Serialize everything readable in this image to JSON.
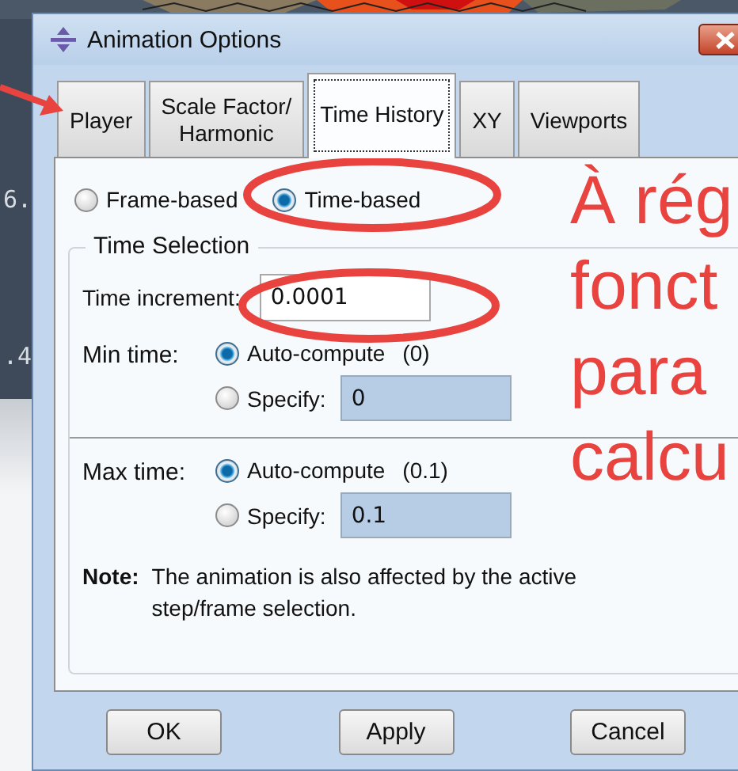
{
  "background_texts": [
    "6.",
    ".4"
  ],
  "window": {
    "title": "Animation Options"
  },
  "tabs": [
    {
      "label": "Player",
      "selected": false
    },
    {
      "label": "Scale Factor/\nHarmonic",
      "selected": false
    },
    {
      "label": "Time History",
      "selected": true
    },
    {
      "label": "XY",
      "selected": false
    },
    {
      "label": "Viewports",
      "selected": false
    }
  ],
  "mode_options": [
    {
      "label": "Frame-based",
      "selected": false
    },
    {
      "label": "Time-based",
      "selected": true
    }
  ],
  "time_selection": {
    "title": "Time Selection",
    "increment_label": "Time increment:",
    "increment_value": "0.0001",
    "limits": [
      {
        "label": "Min time:",
        "auto_label": "Auto-compute",
        "auto_value": "(0)",
        "auto_selected": true,
        "specify_label": "Specify:",
        "specify_value": "0",
        "specify_selected": false
      },
      {
        "label": "Max time:",
        "auto_label": "Auto-compute",
        "auto_value": "(0.1)",
        "auto_selected": true,
        "specify_label": "Specify:",
        "specify_value": "0.1",
        "specify_selected": false
      }
    ]
  },
  "note": {
    "label": "Note:",
    "text": "The animation is also affected by the active step/frame selection."
  },
  "buttons": [
    "OK",
    "Apply",
    "Cancel"
  ],
  "annotation": {
    "lines": [
      "À rég",
      "fonct",
      "para",
      "calcu"
    ]
  }
}
